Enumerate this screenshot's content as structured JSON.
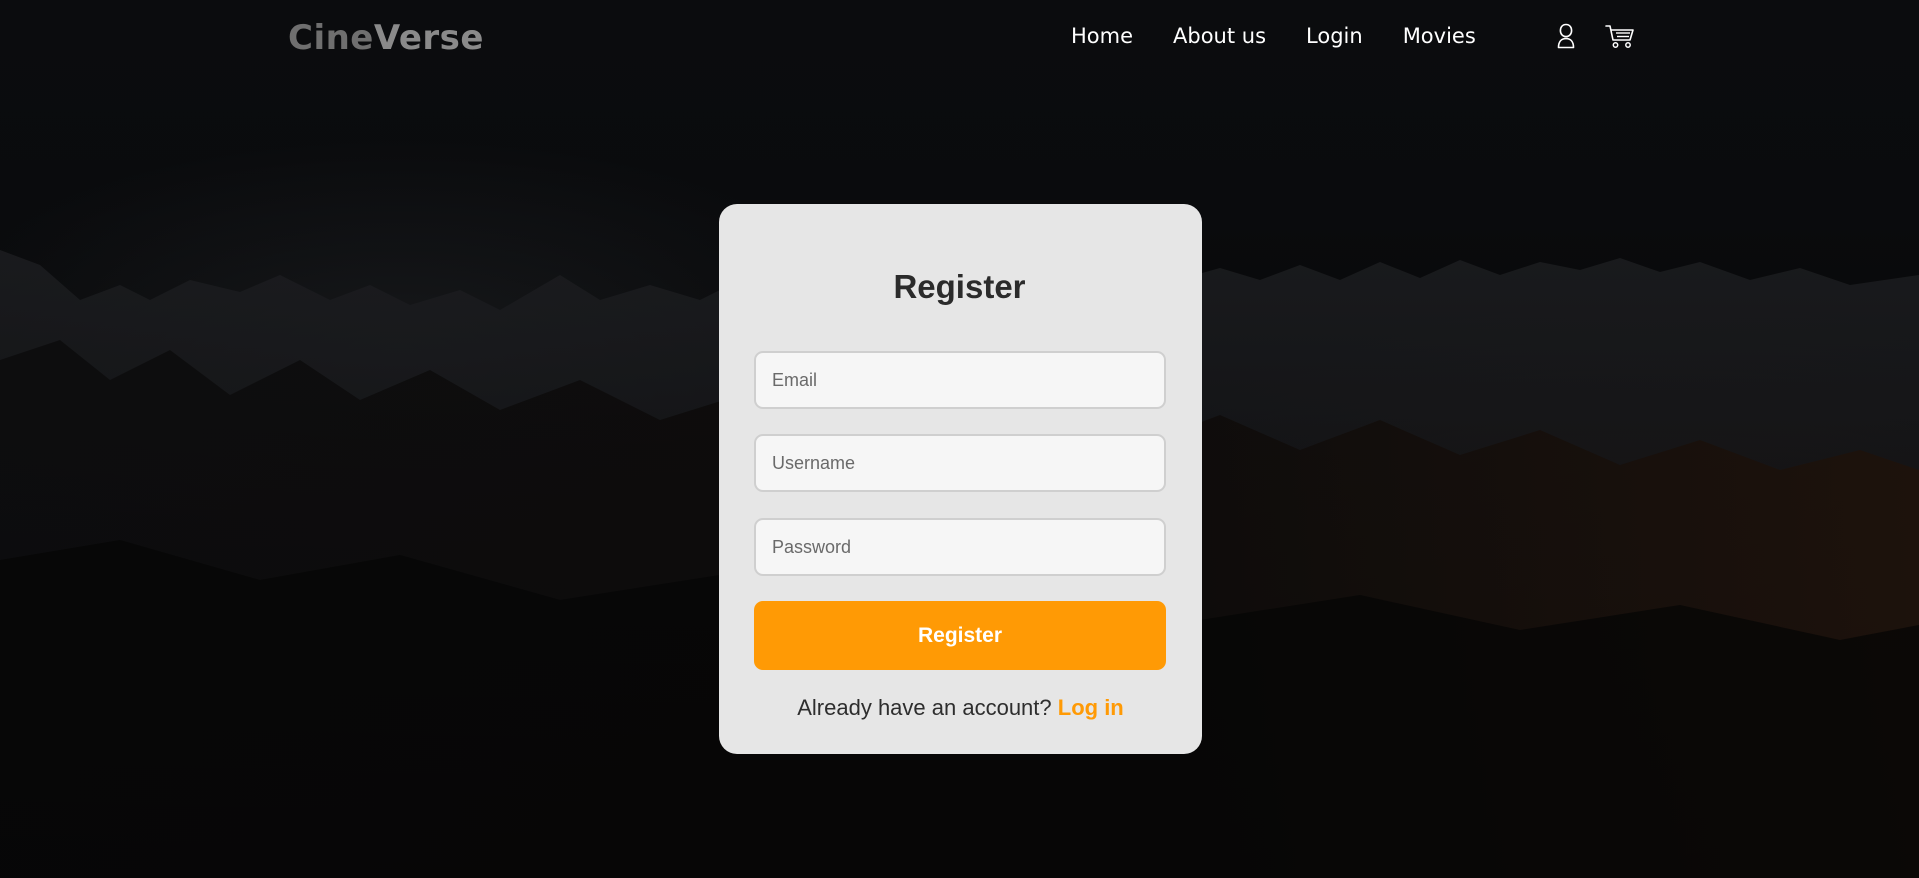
{
  "brand": {
    "part1": "Cine",
    "part2": "Verse"
  },
  "nav": {
    "items": [
      {
        "label": "Home"
      },
      {
        "label": "About us"
      },
      {
        "label": "Login"
      },
      {
        "label": "Movies"
      }
    ],
    "icons": [
      "user-icon",
      "cart-icon"
    ]
  },
  "register": {
    "title": "Register",
    "email_placeholder": "Email",
    "username_placeholder": "Username",
    "password_placeholder": "Password",
    "submit_label": "Register",
    "prompt_text": "Already have an account?",
    "login_link": "Log in"
  },
  "colors": {
    "accent": "#ff9a05",
    "card_bg": "#e6e6e6",
    "page_bg": "#050506"
  }
}
